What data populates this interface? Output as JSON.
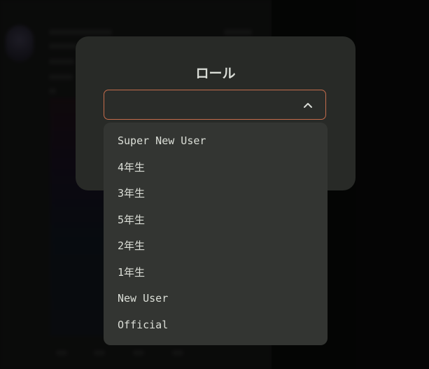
{
  "modal": {
    "title": "ロール",
    "select": {
      "value": "",
      "expanded": true
    }
  },
  "dropdown": {
    "options": [
      "Super New User",
      "4年生",
      "3年生",
      "5年生",
      "2年生",
      "1年生",
      "New User",
      "Official"
    ]
  },
  "colors": {
    "modal_bg": "#282a27",
    "dropdown_bg": "#333532",
    "select_border_focus": "#c46c4c",
    "text": "#dcdfd8"
  },
  "icons": {
    "select_toggle": "chevron-up-icon"
  }
}
